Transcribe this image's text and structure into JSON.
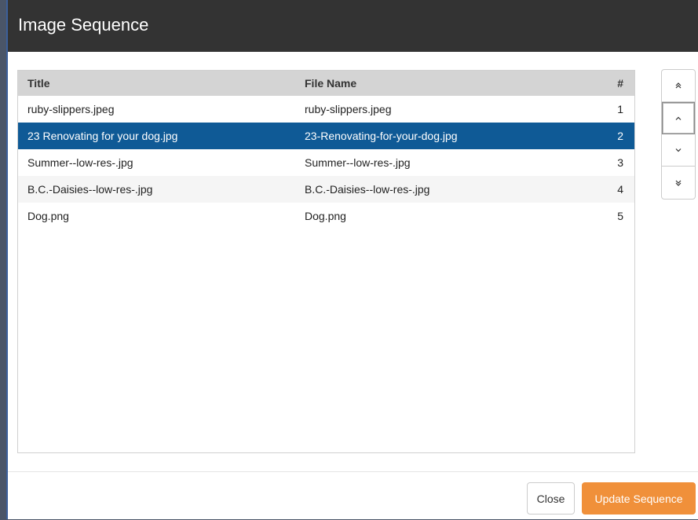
{
  "dialog": {
    "title": "Image Sequence"
  },
  "table": {
    "columns": {
      "title": "Title",
      "file_name": "File Name",
      "number": "#"
    },
    "rows": [
      {
        "title": "ruby-slippers.jpeg",
        "file_name": "ruby-slippers.jpeg",
        "number": "1",
        "selected": false
      },
      {
        "title": "23 Renovating for your dog.jpg",
        "file_name": "23-Renovating-for-your-dog.jpg",
        "number": "2",
        "selected": true
      },
      {
        "title": "Summer--low-res-.jpg",
        "file_name": "Summer--low-res-.jpg",
        "number": "3",
        "selected": false
      },
      {
        "title": "B.C.-Daisies--low-res-.jpg",
        "file_name": "B.C.-Daisies--low-res-.jpg",
        "number": "4",
        "selected": false
      },
      {
        "title": "Dog.png",
        "file_name": "Dog.png",
        "number": "5",
        "selected": false
      }
    ]
  },
  "side_buttons": [
    {
      "icon": "double-chevron-up-icon"
    },
    {
      "icon": "chevron-up-icon"
    },
    {
      "icon": "chevron-down-icon"
    },
    {
      "icon": "double-chevron-down-icon"
    }
  ],
  "footer": {
    "close_label": "Close",
    "update_label": "Update Sequence"
  },
  "colors": {
    "titlebar": "#333333",
    "selected_row": "#0f5a96",
    "update_button": "#f0903a",
    "header_row": "#d4d4d4"
  }
}
